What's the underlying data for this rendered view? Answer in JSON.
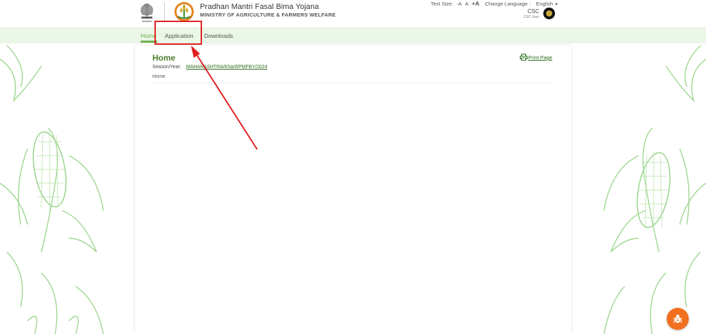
{
  "header": {
    "title": "Pradhan Mantri Fasal Bima Yojana",
    "subtitle": "MINISTRY OF AGRICULTURE & FARMERS WELFARE",
    "text_size_label": "Text Size:",
    "text_size_small": "-A",
    "text_size_normal": "A",
    "text_size_large": "+A",
    "language_label": "Change Language :",
    "language_value": "English",
    "user_name": "CSC",
    "user_role": "CSC User"
  },
  "nav": {
    "items": [
      {
        "label": "Home",
        "active": true
      },
      {
        "label": "Application",
        "active": false
      },
      {
        "label": "Downloads",
        "active": false
      }
    ]
  },
  "main": {
    "title": "Home",
    "season_label": "Season/Year:",
    "season_value": "MAHARASHTRA/Kharif/PMFBY/2024",
    "breadcrumb": "Home",
    "print_label": "Print Page"
  },
  "colors": {
    "accent_green": "#6ab04c",
    "nav_bg": "#eaf6e6",
    "annotation_red": "#e01e1e",
    "bug_button": "#f07020"
  }
}
